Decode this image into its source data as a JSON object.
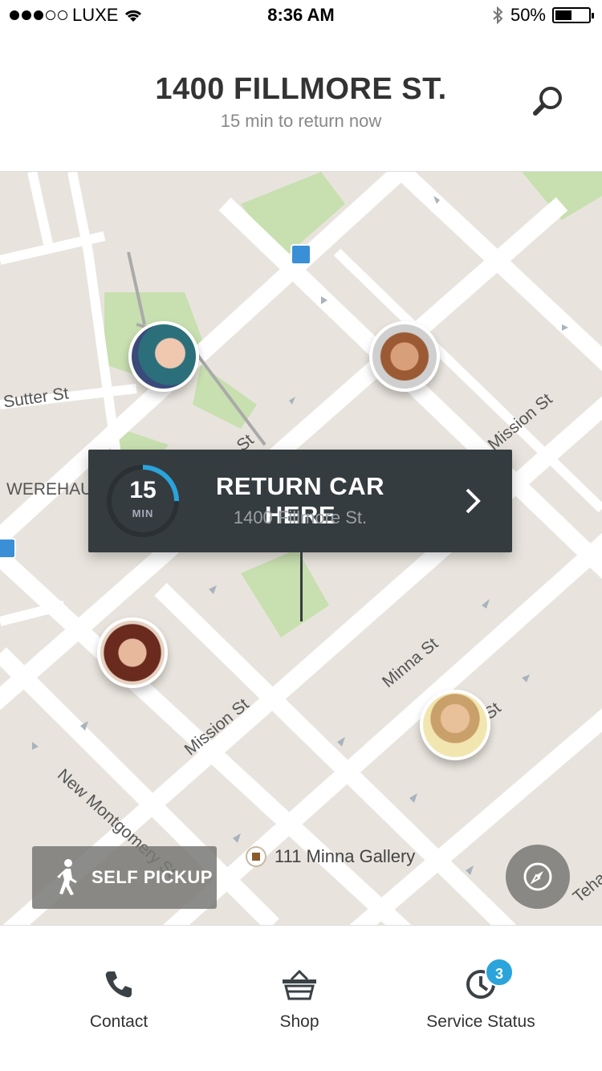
{
  "status_bar": {
    "carrier": "LUXE",
    "time": "8:36 AM",
    "battery": "50%",
    "battery_level": 0.5
  },
  "header": {
    "title": "1400 FILLMORE ST.",
    "subtitle": "15 min to return now",
    "search_icon": "search-icon"
  },
  "map": {
    "streets": [
      "Sutter St",
      "Mission St",
      "Mission St",
      "Minna St",
      "New Montgomery St",
      "WEREHAU",
      "St",
      "St",
      "Teha"
    ],
    "poi": "111 Minna Gallery",
    "return_card": {
      "minutes": "15",
      "minutes_label": "MIN",
      "title": "RETURN CAR HERE",
      "address": "1400 Fillmore St.",
      "progress": 0.25
    },
    "self_pickup": "SELF PICKUP",
    "compass_icon": "compass-icon",
    "accent_color": "#2aa4db",
    "card_color": "#353c40"
  },
  "tabs": [
    {
      "label": "Contact",
      "icon": "phone-icon"
    },
    {
      "label": "Shop",
      "icon": "basket-icon"
    },
    {
      "label": "Service Status",
      "icon": "clock-icon",
      "badge": "3"
    }
  ]
}
